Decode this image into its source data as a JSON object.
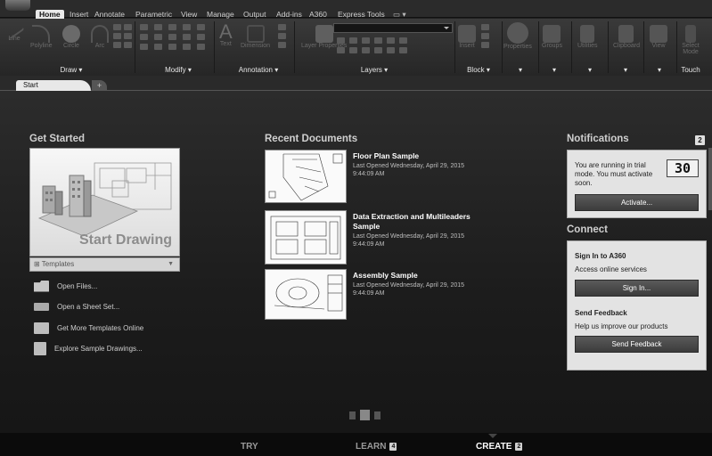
{
  "ribbon": {
    "tabs": [
      "Home",
      "Insert",
      "Annotate",
      "Parametric",
      "View",
      "Manage",
      "Output",
      "Add-ins",
      "A360",
      "Express Tools"
    ],
    "active_tab": "Home",
    "tools": {
      "line": "Line",
      "polyline": "Polyline",
      "circle": "Circle",
      "arc": "Arc",
      "text": "Text",
      "dimension": "Dimension",
      "layer_properties": "Layer Properties",
      "insert": "Insert",
      "properties": "Properties",
      "groups": "Groups",
      "utilities": "Utilities",
      "clipboard": "Clipboard",
      "view": "View",
      "select_mode": "Select Mode"
    },
    "groups": [
      "Draw",
      "Modify",
      "Annotation",
      "Layers",
      "Block",
      "",
      "",
      "",
      "",
      "Touch"
    ]
  },
  "doc_tabs": {
    "start": "Start",
    "new": "+"
  },
  "get_started": {
    "heading": "Get Started",
    "start_drawing": "Start Drawing",
    "templates": "Templates",
    "links": [
      "Open Files...",
      "Open a Sheet Set...",
      "Get More Templates Online",
      "Explore Sample Drawings..."
    ]
  },
  "recent": {
    "heading": "Recent Documents",
    "items": [
      {
        "title": "Floor Plan Sample",
        "opened": "Last Opened Wednesday, April 29, 2015",
        "time": "9:44:09 AM"
      },
      {
        "title": "Data Extraction and Multileaders Sample",
        "opened": "Last Opened Wednesday, April 29, 2015",
        "time": "9:44:09 AM"
      },
      {
        "title": "Assembly Sample",
        "opened": "Last Opened Wednesday, April 29, 2015",
        "time": "9:44:09 AM"
      }
    ]
  },
  "notifications": {
    "heading": "Notifications",
    "count": "2",
    "trial_text": "You are running in trial mode. You must activate soon.",
    "days_left": "30",
    "activate_label": "Activate..."
  },
  "connect": {
    "heading": "Connect",
    "signin_heading": "Sign In to A360",
    "signin_text": "Access online services",
    "signin_label": "Sign In...",
    "feedback_heading": "Send Feedback",
    "feedback_text": "Help us improve our products",
    "feedback_label": "Send Feedback"
  },
  "bottom": {
    "try": "TRY",
    "learn": "LEARN",
    "learn_badge": "4",
    "create": "CREATE",
    "create_badge": "2"
  }
}
